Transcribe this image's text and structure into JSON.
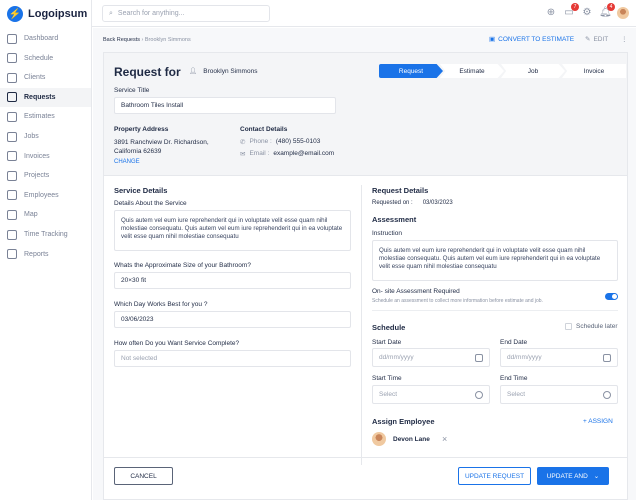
{
  "app": {
    "logo": "Logoipsum"
  },
  "sidebar": {
    "items": [
      {
        "label": "Dashboard"
      },
      {
        "label": "Schedule"
      },
      {
        "label": "Clients"
      },
      {
        "label": "Requests",
        "active": true
      },
      {
        "label": "Estimates"
      },
      {
        "label": "Jobs"
      },
      {
        "label": "Invoices"
      },
      {
        "label": "Projects"
      },
      {
        "label": "Employees"
      },
      {
        "label": "Map"
      },
      {
        "label": "Time Tracking"
      },
      {
        "label": "Reports"
      }
    ]
  },
  "topbar": {
    "search_placeholder": "Search for anything...",
    "messages_badge": "7",
    "notifications_badge": "4"
  },
  "breadcrumb": {
    "back": "Back Requests",
    "current": "Brooklyn Simmons"
  },
  "actions": {
    "convert": "CONVERT TO ESTIMATE",
    "edit": "EDIT"
  },
  "header": {
    "title": "Request for",
    "client": "Brooklyn Simmons",
    "steps": [
      "Request",
      "Estimate",
      "Job",
      "Invoice"
    ],
    "service_title_label": "Service Title",
    "service_title": "Bathroom Tiles Install",
    "property_label": "Property Address",
    "address_line1": "3891 Ranchview Dr. Richardson,",
    "address_line2": "California 62639",
    "change": "CHANGE",
    "contact_label": "Contact Details",
    "phone_label": "Phone :",
    "phone": "(480) 555-0103",
    "email_label": "Email :",
    "email": "example@email.com"
  },
  "service": {
    "title": "Service Details",
    "details_label": "Details About the Service",
    "details": "Quis autem vel eum iure reprehenderit qui in voluptate velit esse quam nihil molestiae consequatu. Quis autem vel eum iure reprehenderit qui in ea voluptate velit esse quam nihil molestiae consequatu",
    "size_label": "Whats the Approximate Size of your Bathroom?",
    "size": "20×30 fit",
    "day_label": "Which Day Works Best for you ?",
    "day": "03/06/2023",
    "freq_label": "How often Do you Want Service Complete?",
    "freq_placeholder": "Not selected"
  },
  "request": {
    "title": "Request Details",
    "requested_label": "Requested on :",
    "requested_on": "03/03/2023",
    "assessment_title": "Assessment",
    "instruction_label": "Instruction",
    "instruction": "Quis autem vel eum iure reprehenderit qui in voluptate velit esse quam nihil molestiae consequatu. Quis autem vel eum iure reprehenderit qui in ea voluptate velit esse quam nihil molestiae consequatu",
    "onsite_label": "On- site Assessment Required",
    "onsite_desc": "Schedule an assessment to collect more information before estimate and job.",
    "onsite_on": true
  },
  "schedule": {
    "title": "Schedule",
    "later": "Schedule later",
    "start_date_label": "Start Date",
    "end_date_label": "End Date",
    "date_placeholder": "dd/mm/yyyy",
    "start_time_label": "Start Time",
    "end_time_label": "End Time",
    "time_placeholder": "Select"
  },
  "assign": {
    "title": "Assign Employee",
    "button": "+ ASSIGN",
    "employee": "Devon Lane"
  },
  "footer": {
    "cancel": "CANCEL",
    "update_request": "UPDATE REQUEST",
    "update_and": "UPDATE AND"
  },
  "colors": {
    "accent": "#1a73e8"
  }
}
